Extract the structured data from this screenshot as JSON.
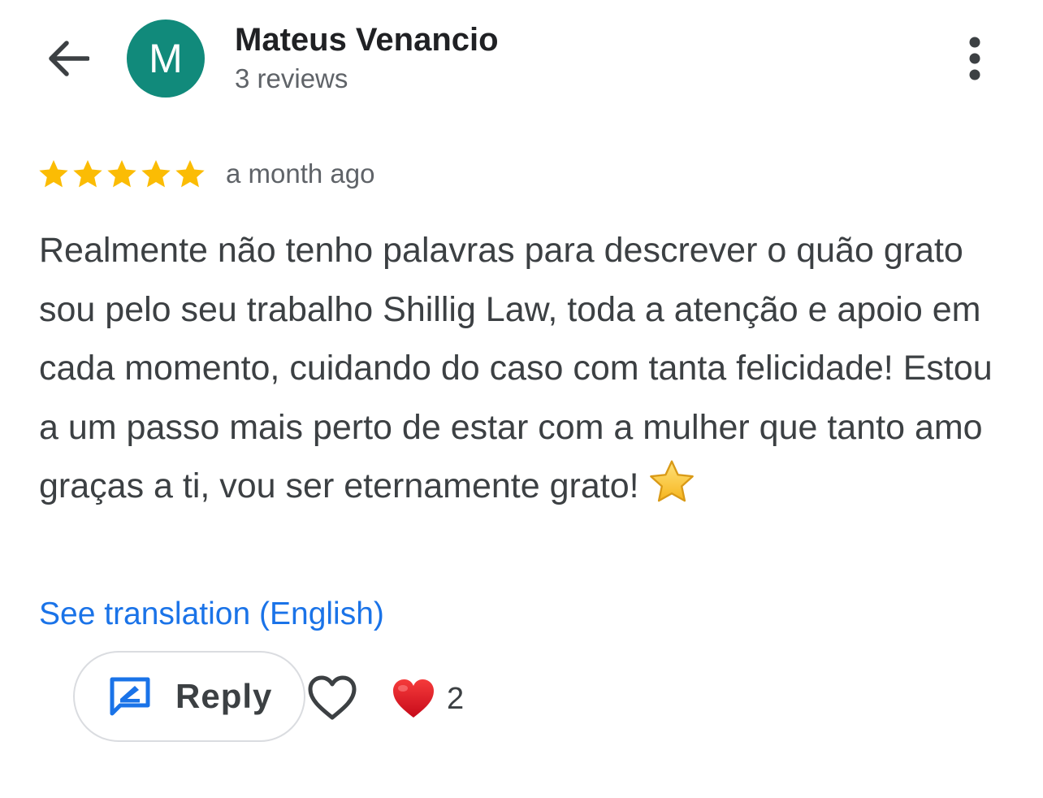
{
  "header": {
    "back_icon": "arrow-back-icon",
    "avatar_initial": "M",
    "avatar_color": "#118a7b",
    "user_name": "Mateus Venancio",
    "review_count": "3 reviews",
    "more_icon": "more-vertical-icon"
  },
  "review": {
    "rating": 5,
    "rating_max": 5,
    "star_color": "#fbbc04",
    "date": "a month ago",
    "text": "Realmente não tenho palavras para descrever o quão grato sou pelo seu trabalho Shillig Law, toda a atenção e apoio em cada momento, cuidando do caso com tanta felicidade! Estou a um passo mais perto de estar com a mulher que tanto amo graças a ti, vou ser eternamente grato!",
    "text_emoji": "star-emoji",
    "translation_link": "See translation (English)"
  },
  "actions": {
    "reply_label": "Reply",
    "reply_icon": "rate-review-icon",
    "like_icon": "heart-outline-icon",
    "reaction_icon": "red-heart-icon",
    "reaction_count": "2"
  },
  "colors": {
    "link": "#1a73e8",
    "reply_icon": "#1a73e8",
    "heart": "#e0122a"
  }
}
